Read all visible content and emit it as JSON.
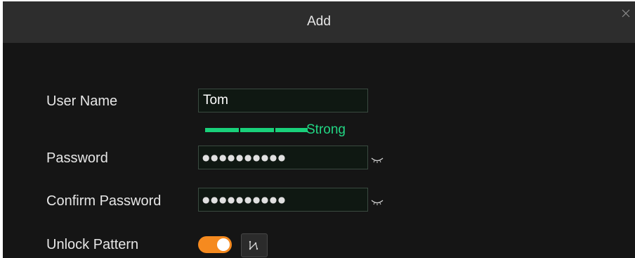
{
  "dialog": {
    "title": "Add",
    "close_icon": "close-icon"
  },
  "form": {
    "username": {
      "label": "User Name",
      "value": "Tom"
    },
    "strength": {
      "label": "Strong",
      "level_fraction": 1,
      "color": "#19d07a"
    },
    "password": {
      "label": "Password",
      "masked": "●●●●●●●●●●",
      "toggle_icon": "eye-closed-icon"
    },
    "confirm_password": {
      "label": "Confirm Password",
      "masked": "●●●●●●●●●●",
      "toggle_icon": "eye-closed-icon"
    },
    "unlock_pattern": {
      "label": "Unlock Pattern",
      "enabled": true,
      "toggle_color": "#f58a1f",
      "pattern_icon": "unlock-pattern-icon"
    }
  }
}
